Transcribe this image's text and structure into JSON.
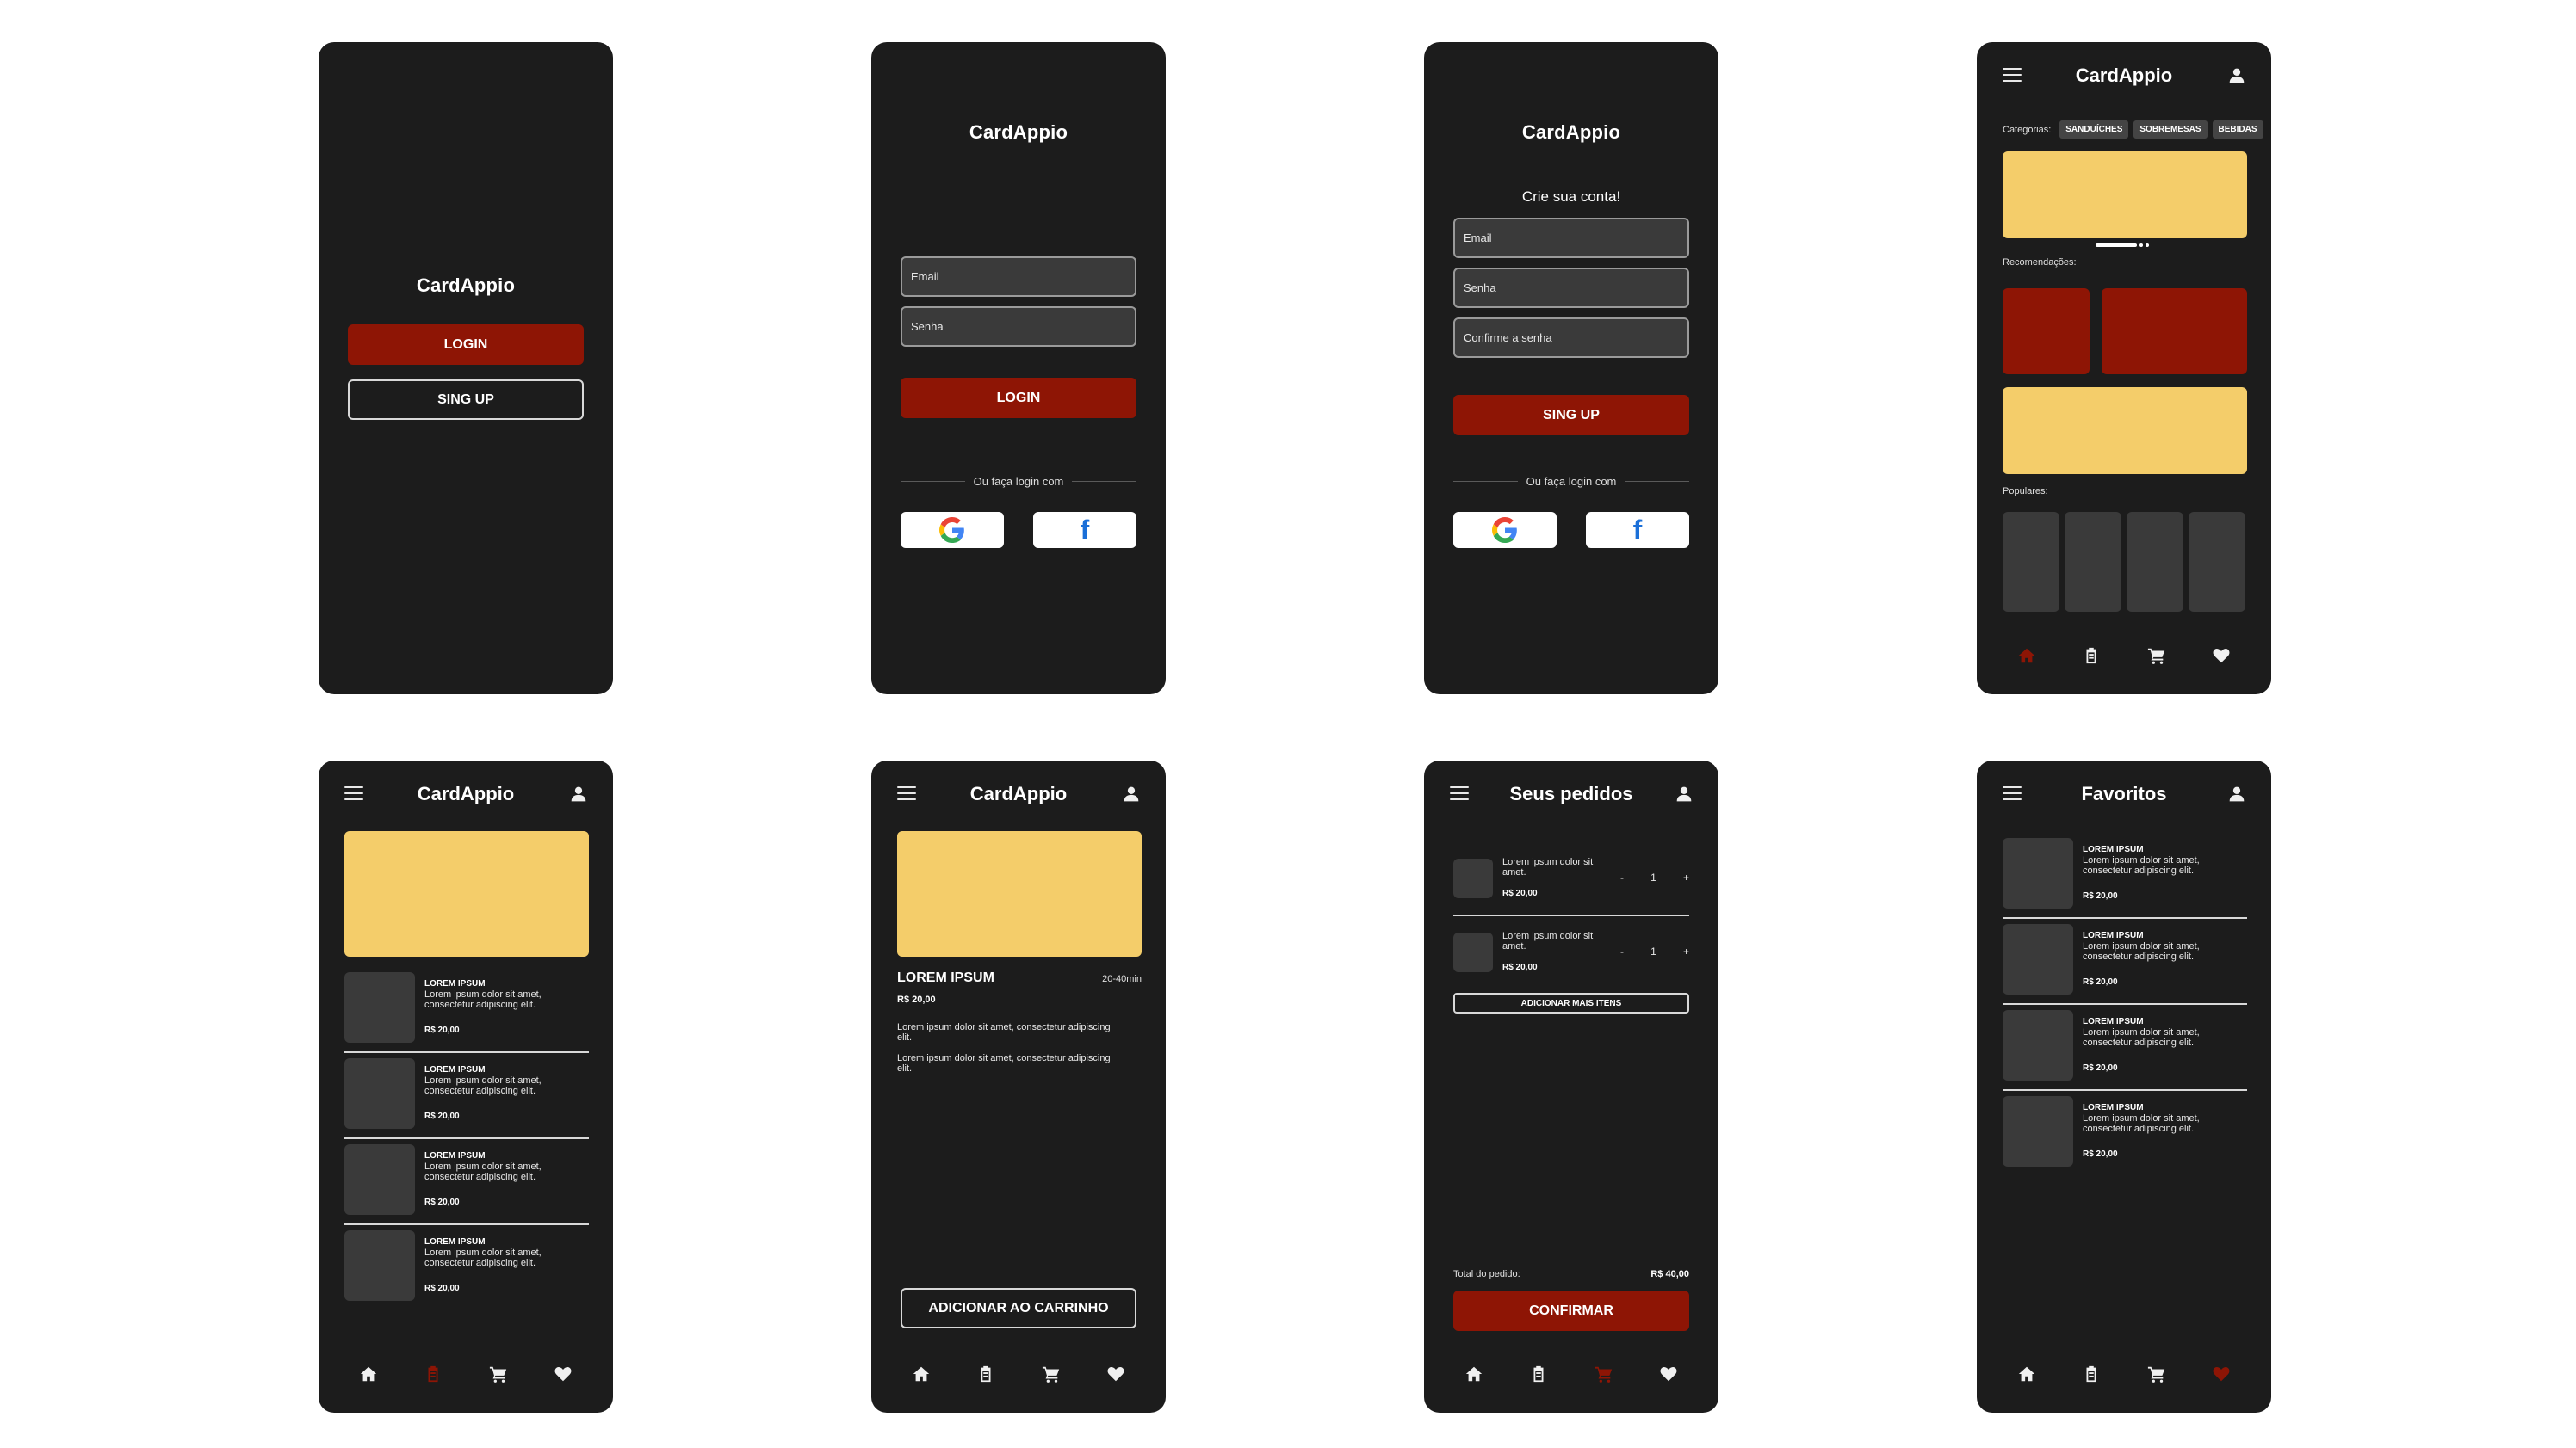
{
  "brand": "CardAppio",
  "colors": {
    "background": "#1c1c1c",
    "accent_red": "#8e1505",
    "accent_yellow": "#f4cd6a",
    "card_grey": "#3a3a3a",
    "nav_active": "#8e1505"
  },
  "splash": {
    "title": "CardAppio",
    "login_label": "LOGIN",
    "signup_label": "SING UP"
  },
  "login": {
    "title": "CardAppio",
    "email_placeholder": "Email",
    "password_placeholder": "Senha",
    "login_label": "LOGIN",
    "divider_text": "Ou faça login com",
    "google_icon": "google-icon",
    "facebook_icon": "facebook-icon",
    "facebook_glyph": "f"
  },
  "signup": {
    "title": "CardAppio",
    "subtitle": "Crie sua conta!",
    "email_placeholder": "Email",
    "password_placeholder": "Senha",
    "confirm_placeholder": "Confirme a senha",
    "signup_label": "SING UP",
    "divider_text": "Ou faça login com",
    "facebook_glyph": "f"
  },
  "home": {
    "title": "CardAppio",
    "categories_label": "Categorias:",
    "categories": [
      "SANDUÍCHES",
      "SOBREMESAS",
      "BEBIDAS"
    ],
    "recommendations_label": "Recomendações:",
    "popular_label": "Populares:"
  },
  "menu_list": {
    "title": "CardAppio",
    "items": [
      {
        "title": "LOREM IPSUM",
        "desc": "Lorem ipsum dolor sit amet, consectetur adipiscing elit.",
        "price": "R$ 20,00"
      },
      {
        "title": "LOREM IPSUM",
        "desc": "Lorem ipsum dolor sit amet, consectetur adipiscing elit.",
        "price": "R$ 20,00"
      },
      {
        "title": "LOREM IPSUM",
        "desc": "Lorem ipsum dolor sit amet, consectetur adipiscing elit.",
        "price": "R$ 20,00"
      },
      {
        "title": "LOREM IPSUM",
        "desc": "Lorem ipsum dolor sit amet, consectetur adipiscing elit.",
        "price": "R$ 20,00"
      }
    ]
  },
  "product": {
    "title": "CardAppio",
    "name": "LOREM IPSUM",
    "time": "20-40min",
    "price": "R$ 20,00",
    "desc1": "Lorem ipsum dolor sit amet, consectetur adipiscing elit.",
    "desc2": "Lorem ipsum dolor sit amet, consectetur adipiscing elit.",
    "add_to_cart_label": "ADICIONAR AO CARRINHO"
  },
  "orders": {
    "title": "Seus pedidos",
    "items": [
      {
        "desc": "Lorem ipsum dolor sit amet.",
        "price": "R$ 20,00",
        "minus": "-",
        "qty": "1",
        "plus": "+"
      },
      {
        "desc": "Lorem ipsum dolor sit amet.",
        "price": "R$ 20,00",
        "minus": "-",
        "qty": "1",
        "plus": "+"
      }
    ],
    "add_more_label": "ADICIONAR MAIS ITENS",
    "total_label": "Total do pedido:",
    "total_value": "R$ 40,00",
    "confirm_label": "CONFIRMAR"
  },
  "favorites": {
    "title": "Favoritos",
    "items": [
      {
        "title": "LOREM IPSUM",
        "desc": "Lorem ipsum dolor sit amet, consectetur adipiscing elit.",
        "price": "R$ 20,00"
      },
      {
        "title": "LOREM IPSUM",
        "desc": "Lorem ipsum dolor sit amet, consectetur adipiscing elit.",
        "price": "R$ 20,00"
      },
      {
        "title": "LOREM IPSUM",
        "desc": "Lorem ipsum dolor sit amet, consectetur adipiscing elit.",
        "price": "R$ 20,00"
      },
      {
        "title": "LOREM IPSUM",
        "desc": "Lorem ipsum dolor sit amet, consectetur adipiscing elit.",
        "price": "R$ 20,00"
      }
    ]
  },
  "nav_icons": [
    "home-icon",
    "menu-list-icon",
    "cart-icon",
    "heart-icon"
  ]
}
